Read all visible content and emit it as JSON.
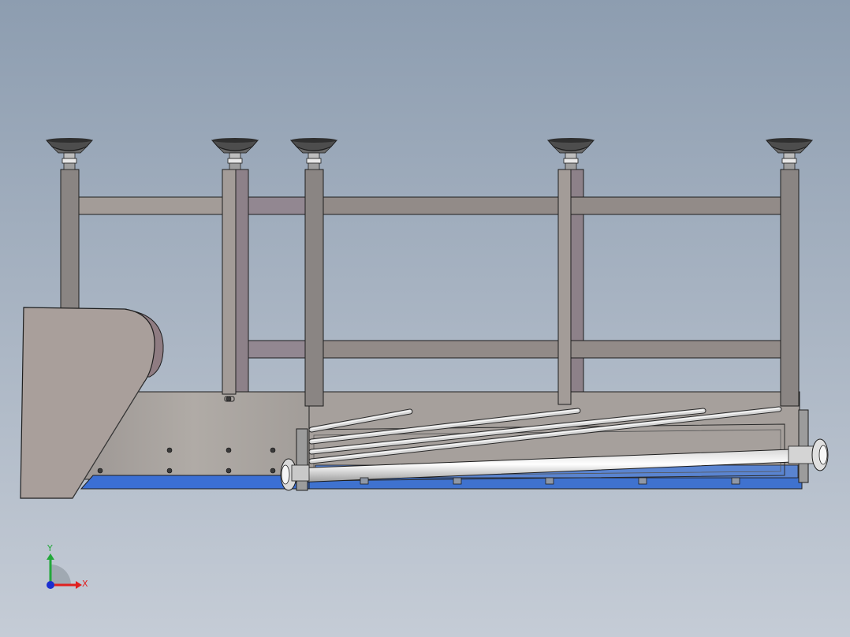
{
  "view": {
    "background_top": "#8d9db0",
    "background_bottom": "#c5ccd6"
  },
  "colors": {
    "frame": "#8a8583",
    "frame_light": "#a39c98",
    "frame_back": "#928791",
    "plate": "#a7a29e",
    "hopper": "#a99f9b",
    "roller": "#f4f4f4",
    "base_blue": "#3b6fd4",
    "edge": "#1e1e1e"
  },
  "triad": {
    "x_label": "X",
    "y_label": "Y",
    "x_color": "#e02020",
    "y_color": "#22a83a",
    "z_color": "#1b2fd0"
  },
  "parts": {
    "leveling_feet": 5,
    "frame_posts": 5,
    "slanted_rods": 4,
    "main_roller": 1
  }
}
